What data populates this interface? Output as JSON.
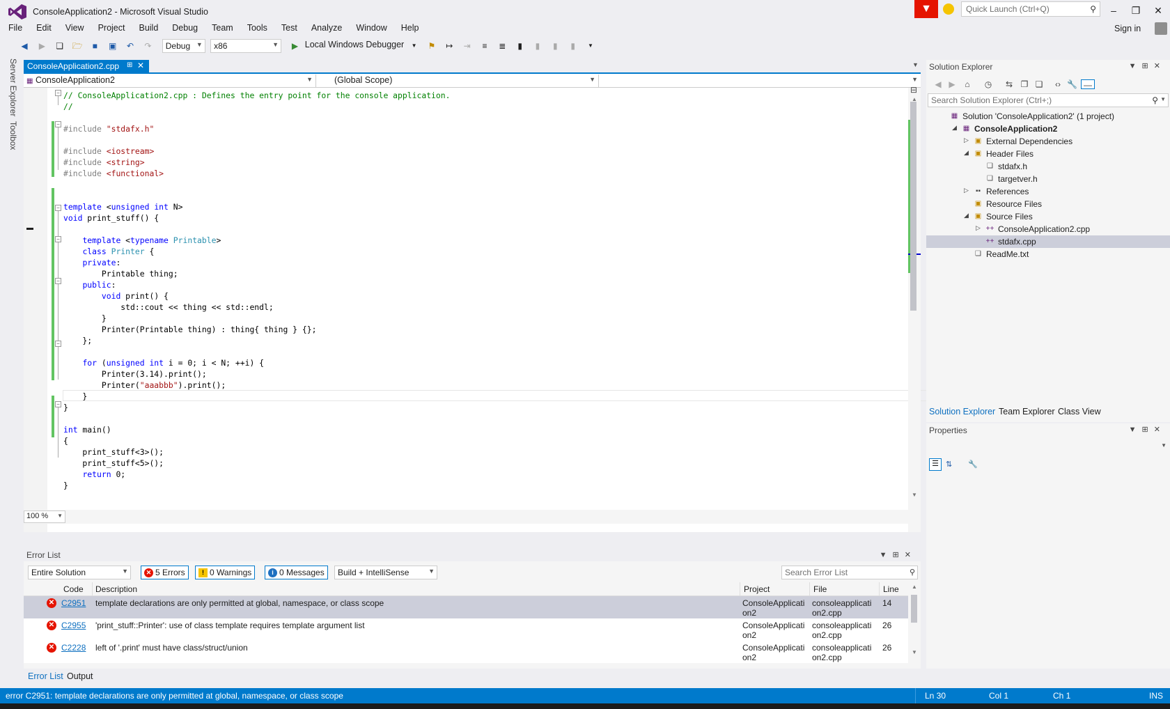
{
  "window": {
    "title": "ConsoleApplication2 - Microsoft Visual Studio",
    "quick_launch_placeholder": "Quick Launch (Ctrl+Q)",
    "sign_in": "Sign in"
  },
  "menu": [
    "File",
    "Edit",
    "View",
    "Project",
    "Build",
    "Debug",
    "Team",
    "Tools",
    "Test",
    "Analyze",
    "Window",
    "Help"
  ],
  "toolbar": {
    "config": "Debug",
    "platform": "x86",
    "debugger": "Local Windows Debugger"
  },
  "side_tabs": [
    "Server Explorer",
    "Toolbox"
  ],
  "editor": {
    "tab_label": "ConsoleApplication2.cpp",
    "nav_project": "ConsoleApplication2",
    "nav_scope": "(Global Scope)",
    "zoom": "100 %"
  },
  "code_lines": [
    [
      {
        "c": "cmt",
        "t": "// ConsoleApplication2.cpp : Defines the entry point for the console application."
      }
    ],
    [
      {
        "c": "cmt",
        "t": "//"
      }
    ],
    [],
    [
      {
        "c": "pp",
        "t": "#include "
      },
      {
        "c": "str",
        "t": "\"stdafx.h\""
      }
    ],
    [],
    [
      {
        "c": "pp",
        "t": "#include "
      },
      {
        "c": "str",
        "t": "<iostream>"
      }
    ],
    [
      {
        "c": "pp",
        "t": "#include "
      },
      {
        "c": "str",
        "t": "<string>"
      }
    ],
    [
      {
        "c": "pp",
        "t": "#include "
      },
      {
        "c": "str",
        "t": "<functional>"
      }
    ],
    [],
    [],
    [
      {
        "c": "kw",
        "t": "template"
      },
      {
        "c": "",
        "t": " <"
      },
      {
        "c": "kw",
        "t": "unsigned int"
      },
      {
        "c": "",
        "t": " N>"
      }
    ],
    [
      {
        "c": "kw",
        "t": "void"
      },
      {
        "c": "",
        "t": " print_stuff() {"
      }
    ],
    [],
    [
      {
        "c": "",
        "t": "    "
      },
      {
        "c": "kw",
        "t": "template"
      },
      {
        "c": "",
        "t": " <"
      },
      {
        "c": "kw",
        "t": "typename"
      },
      {
        "c": "",
        "t": " "
      },
      {
        "c": "typ",
        "t": "Printable"
      },
      {
        "c": "",
        "t": ">"
      }
    ],
    [
      {
        "c": "",
        "t": "    "
      },
      {
        "c": "kw",
        "t": "class"
      },
      {
        "c": "",
        "t": " "
      },
      {
        "c": "typ",
        "t": "Printer"
      },
      {
        "c": "",
        "t": " {"
      }
    ],
    [
      {
        "c": "",
        "t": "    "
      },
      {
        "c": "kw",
        "t": "private"
      },
      {
        "c": "",
        "t": ":"
      }
    ],
    [
      {
        "c": "",
        "t": "        Printable thing;"
      }
    ],
    [
      {
        "c": "",
        "t": "    "
      },
      {
        "c": "kw",
        "t": "public"
      },
      {
        "c": "",
        "t": ":"
      }
    ],
    [
      {
        "c": "",
        "t": "        "
      },
      {
        "c": "kw",
        "t": "void"
      },
      {
        "c": "",
        "t": " print() {"
      }
    ],
    [
      {
        "c": "",
        "t": "            std::cout << thing << std::endl;"
      }
    ],
    [
      {
        "c": "",
        "t": "        }"
      }
    ],
    [
      {
        "c": "",
        "t": "        Printer(Printable thing) : thing{ thing } {};"
      }
    ],
    [
      {
        "c": "",
        "t": "    };"
      }
    ],
    [],
    [
      {
        "c": "",
        "t": "    "
      },
      {
        "c": "kw",
        "t": "for"
      },
      {
        "c": "",
        "t": " ("
      },
      {
        "c": "kw",
        "t": "unsigned int"
      },
      {
        "c": "",
        "t": " i = 0; i < N; ++i) {"
      }
    ],
    [
      {
        "c": "",
        "t": "        Printer(3.14).print();"
      }
    ],
    [
      {
        "c": "",
        "t": "        Printer("
      },
      {
        "c": "str",
        "t": "\"aaabbb\""
      },
      {
        "c": "",
        "t": ").print();"
      }
    ],
    [
      {
        "c": "",
        "t": "    }"
      }
    ],
    [
      {
        "c": "",
        "t": "}"
      }
    ],
    [],
    [
      {
        "c": "kw",
        "t": "int"
      },
      {
        "c": "",
        "t": " main()"
      }
    ],
    [
      {
        "c": "",
        "t": "{"
      }
    ],
    [
      {
        "c": "",
        "t": "    print_stuff<3>();"
      }
    ],
    [
      {
        "c": "",
        "t": "    print_stuff<5>();"
      }
    ],
    [
      {
        "c": "",
        "t": "    "
      },
      {
        "c": "kw",
        "t": "return"
      },
      {
        "c": "",
        "t": " 0;"
      }
    ],
    [
      {
        "c": "",
        "t": "}"
      }
    ]
  ],
  "error_list": {
    "title": "Error List",
    "scope": "Entire Solution",
    "errors_btn": "5 Errors",
    "warnings_btn": "0 Warnings",
    "messages_btn": "0 Messages",
    "filter": "Build + IntelliSense",
    "search_placeholder": "Search Error List",
    "columns": {
      "code": "Code",
      "description": "Description",
      "project": "Project",
      "file": "File",
      "line": "Line"
    },
    "rows": [
      {
        "code": "C2951",
        "description": "template declarations are only permitted at global, namespace, or class scope",
        "project": "ConsoleApplication2",
        "file": "consoleapplication2.cpp",
        "line": "14"
      },
      {
        "code": "C2955",
        "description": "'print_stuff::Printer': use of class template requires template argument list",
        "project": "ConsoleApplication2",
        "file": "consoleapplication2.cpp",
        "line": "26"
      },
      {
        "code": "C2228",
        "description": "left of '.print' must have class/struct/union",
        "project": "ConsoleApplication2",
        "file": "consoleapplication2.cpp",
        "line": "26"
      }
    ],
    "bottom_tabs": [
      "Error List",
      "Output"
    ]
  },
  "solution_explorer": {
    "title": "Solution Explorer",
    "search_placeholder": "Search Solution Explorer (Ctrl+;)",
    "tree": [
      {
        "label": "Solution 'ConsoleApplication2' (1 project)",
        "depth": 0,
        "twisty": "",
        "icon": "solution-icon",
        "bold": false,
        "selected": false
      },
      {
        "label": "ConsoleApplication2",
        "depth": 1,
        "twisty": "expanded",
        "icon": "project-icon",
        "bold": true,
        "selected": false
      },
      {
        "label": "External Dependencies",
        "depth": 2,
        "twisty": "collapsed",
        "icon": "folder-icon",
        "bold": false,
        "selected": false
      },
      {
        "label": "Header Files",
        "depth": 2,
        "twisty": "expanded",
        "icon": "folder-icon",
        "bold": false,
        "selected": false
      },
      {
        "label": "stdafx.h",
        "depth": 3,
        "twisty": "",
        "icon": "header-file-icon",
        "bold": false,
        "selected": false
      },
      {
        "label": "targetver.h",
        "depth": 3,
        "twisty": "",
        "icon": "header-file-icon",
        "bold": false,
        "selected": false
      },
      {
        "label": "References",
        "depth": 2,
        "twisty": "collapsed",
        "icon": "references-icon",
        "bold": false,
        "selected": false
      },
      {
        "label": "Resource Files",
        "depth": 2,
        "twisty": "",
        "icon": "folder-icon",
        "bold": false,
        "selected": false
      },
      {
        "label": "Source Files",
        "depth": 2,
        "twisty": "expanded",
        "icon": "folder-icon",
        "bold": false,
        "selected": false
      },
      {
        "label": "ConsoleApplication2.cpp",
        "depth": 3,
        "twisty": "collapsed",
        "icon": "cpp-file-icon",
        "bold": false,
        "selected": false
      },
      {
        "label": "stdafx.cpp",
        "depth": 3,
        "twisty": "",
        "icon": "cpp-file-icon",
        "bold": false,
        "selected": true
      },
      {
        "label": "ReadMe.txt",
        "depth": 2,
        "twisty": "",
        "icon": "text-file-icon",
        "bold": false,
        "selected": false
      }
    ],
    "tabs": [
      "Solution Explorer",
      "Team Explorer",
      "Class View"
    ]
  },
  "properties": {
    "title": "Properties"
  },
  "status": {
    "message": "error C2951: template declarations are only permitted at global, namespace, or class scope",
    "line": "Ln 30",
    "col": "Col 1",
    "ch": "Ch 1",
    "mode": "INS"
  },
  "colors": {
    "accent": "#007acc",
    "error": "#e51400",
    "selection": "#ccceda"
  }
}
